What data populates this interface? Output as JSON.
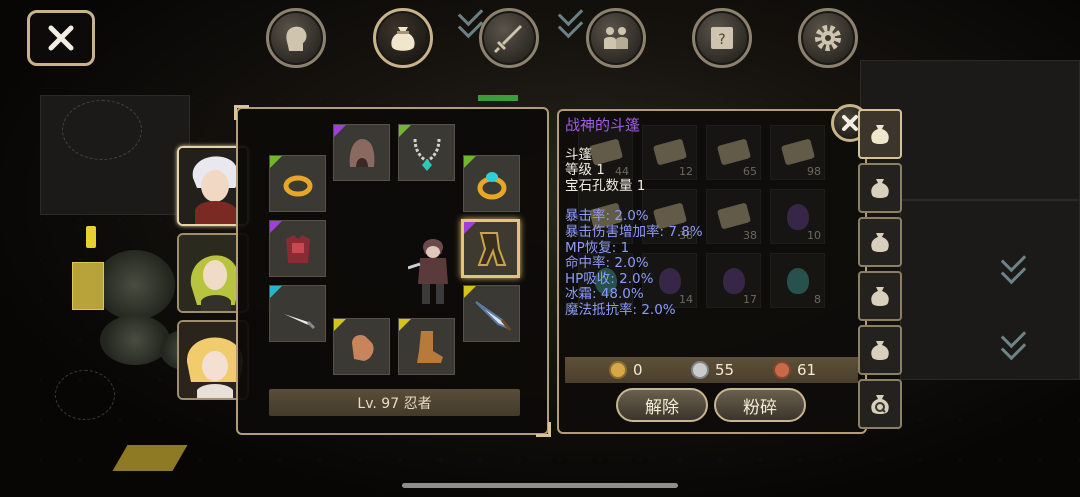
{
  "top_menu": [
    {
      "name": "character-menu-button",
      "icon": "head-icon",
      "active": false
    },
    {
      "name": "bag-menu-button",
      "icon": "bag-icon",
      "active": true
    },
    {
      "name": "skills-menu-button",
      "icon": "sword-icon",
      "active": false
    },
    {
      "name": "party-menu-button",
      "icon": "people-icon",
      "active": false
    },
    {
      "name": "quest-menu-button",
      "icon": "scroll-icon",
      "active": false
    },
    {
      "name": "settings-menu-button",
      "icon": "gear-icon",
      "active": false
    }
  ],
  "character": {
    "level_label": "Lv. 97 忍者"
  },
  "equipment_slots": [
    {
      "slot": "helmet",
      "icon": "hood-icon",
      "rarity_color": "#a23fd8"
    },
    {
      "slot": "necklace",
      "icon": "necklace-icon",
      "rarity_color": "#6fb82e"
    },
    {
      "slot": "ring-left",
      "icon": "ring-icon",
      "rarity_color": "#6fb82e"
    },
    {
      "slot": "ring-right",
      "icon": "jewel-ring-icon",
      "rarity_color": "#6fb82e"
    },
    {
      "slot": "armor",
      "icon": "armor-icon",
      "rarity_color": "#a23fd8"
    },
    {
      "slot": "cloak",
      "icon": "cloak-icon",
      "rarity_color": "#a23fd8",
      "selected": true
    },
    {
      "slot": "weapon-left",
      "icon": "sword-icon",
      "rarity_color": "#29b6c8"
    },
    {
      "slot": "weapon-right",
      "icon": "blade-icon",
      "rarity_color": "#d6c21a"
    },
    {
      "slot": "gloves",
      "icon": "glove-icon",
      "rarity_color": "#d6c21a"
    },
    {
      "slot": "boots",
      "icon": "boot-icon",
      "rarity_color": "#d6c21a"
    }
  ],
  "inventory_counts": [
    "44",
    "12",
    "65",
    "98",
    "",
    "38",
    "38",
    "10",
    "",
    "14",
    "17",
    "8"
  ],
  "tooltip": {
    "item_name": "战神的斗篷",
    "item_type": "斗篷",
    "item_level": "等级 1",
    "gem_slots": "宝石孔数量 1",
    "stats": [
      "暴击率: 2.0%",
      "暴击伤害增加率: 7.8%",
      "MP恢复: 1",
      "命中率: 2.0%",
      "HP吸收: 2.0%",
      "冰霜: 48.0%",
      "魔法抵抗率: 2.0%"
    ]
  },
  "currency": {
    "gold": "0",
    "silver": "55",
    "copper": "61"
  },
  "actions": {
    "unequip_label": "解除",
    "smash_label": "粉碎"
  },
  "colors": {
    "frame": "#b39d76",
    "item_name": "#a35ae6",
    "stat_text": "#8c9cf8",
    "gold_coin": "#d8a848",
    "silver_coin": "#c8cccc",
    "copper_coin": "#c86a4a"
  }
}
